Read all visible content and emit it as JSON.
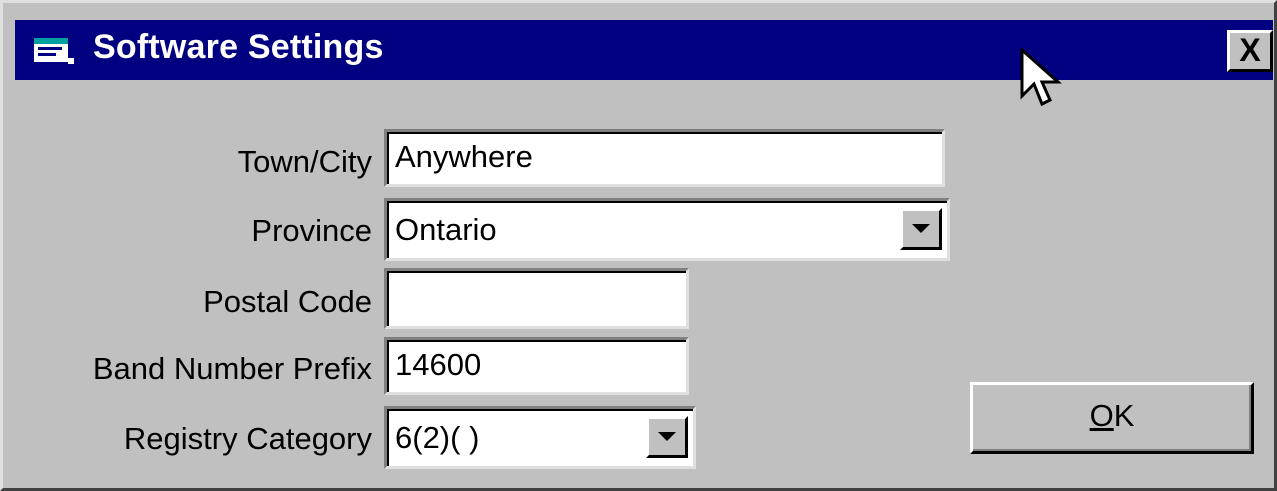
{
  "window": {
    "title": "Software Settings",
    "close_label": "X"
  },
  "form": {
    "town_label": "Town/City",
    "town_value": "Anywhere",
    "province_label": "Province",
    "province_value": "Ontario",
    "postal_label": "Postal Code",
    "postal_value": "",
    "band_label": "Band Number Prefix",
    "band_value": "14600",
    "registry_label": "Registry Category",
    "registry_value": "6(2)( )"
  },
  "buttons": {
    "ok_mnemonic": "O",
    "ok_rest": "K"
  },
  "icons": {
    "title_icon": "app-window-icon",
    "dropdown_icon": "chevron-down-icon",
    "cursor_icon": "mouse-pointer-icon"
  },
  "colors": {
    "titlebar": "#000080",
    "face": "#c0c0c0"
  }
}
